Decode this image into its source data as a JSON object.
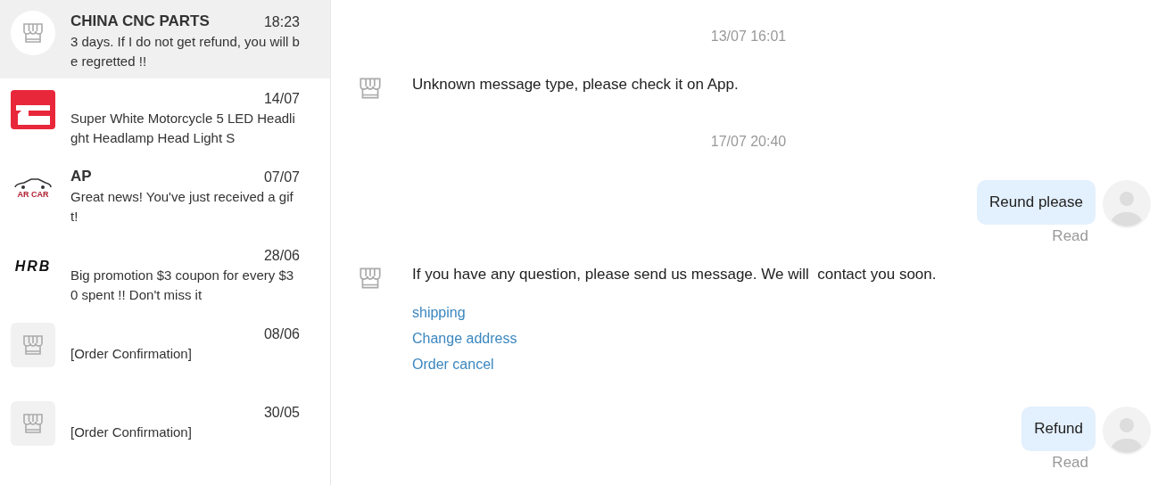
{
  "conversations": [
    {
      "name": "CHINA CNC PARTS",
      "date": "18:23",
      "preview": "3 days. If I do not get refund, you will be regretted !!",
      "avatar": {
        "kind": "store-circle"
      },
      "selected": true
    },
    {
      "date": "14/07",
      "preview": "Super White Motorcycle 5 LED Headlight Headlamp Head Light S",
      "avatar": {
        "kind": "red-logo"
      },
      "selected": false
    },
    {
      "name": "AP",
      "date": "07/07",
      "preview": "Great news! You've just received a gift!",
      "avatar": {
        "kind": "car-logo",
        "text": "AR CAR"
      },
      "selected": false
    },
    {
      "date": "28/06",
      "preview": "Big promotion $3 coupon for every $30 spent !! Don't miss it",
      "avatar": {
        "kind": "text-logo",
        "text": "HRB"
      },
      "selected": false
    },
    {
      "date": "08/06",
      "preview": "[Order Confirmation]",
      "avatar": {
        "kind": "store-square"
      },
      "selected": false
    },
    {
      "date": "30/05",
      "preview": "[Order Confirmation]",
      "avatar": {
        "kind": "store-square"
      },
      "selected": false
    }
  ],
  "messages": [
    {
      "kind": "time",
      "text": "13/07 16:01"
    },
    {
      "kind": "incoming",
      "text": "Unknown message type, please check it on App."
    },
    {
      "kind": "time",
      "text": "17/07 20:40"
    },
    {
      "kind": "outgoing",
      "text": "Reund please",
      "status": "Read"
    },
    {
      "kind": "incoming",
      "text": "If you have any question, please send us message. We will  contact you soon.",
      "links": [
        "shipping",
        "Change address",
        "Order cancel"
      ]
    },
    {
      "kind": "outgoing",
      "text": "Refund",
      "status": "Read"
    }
  ]
}
